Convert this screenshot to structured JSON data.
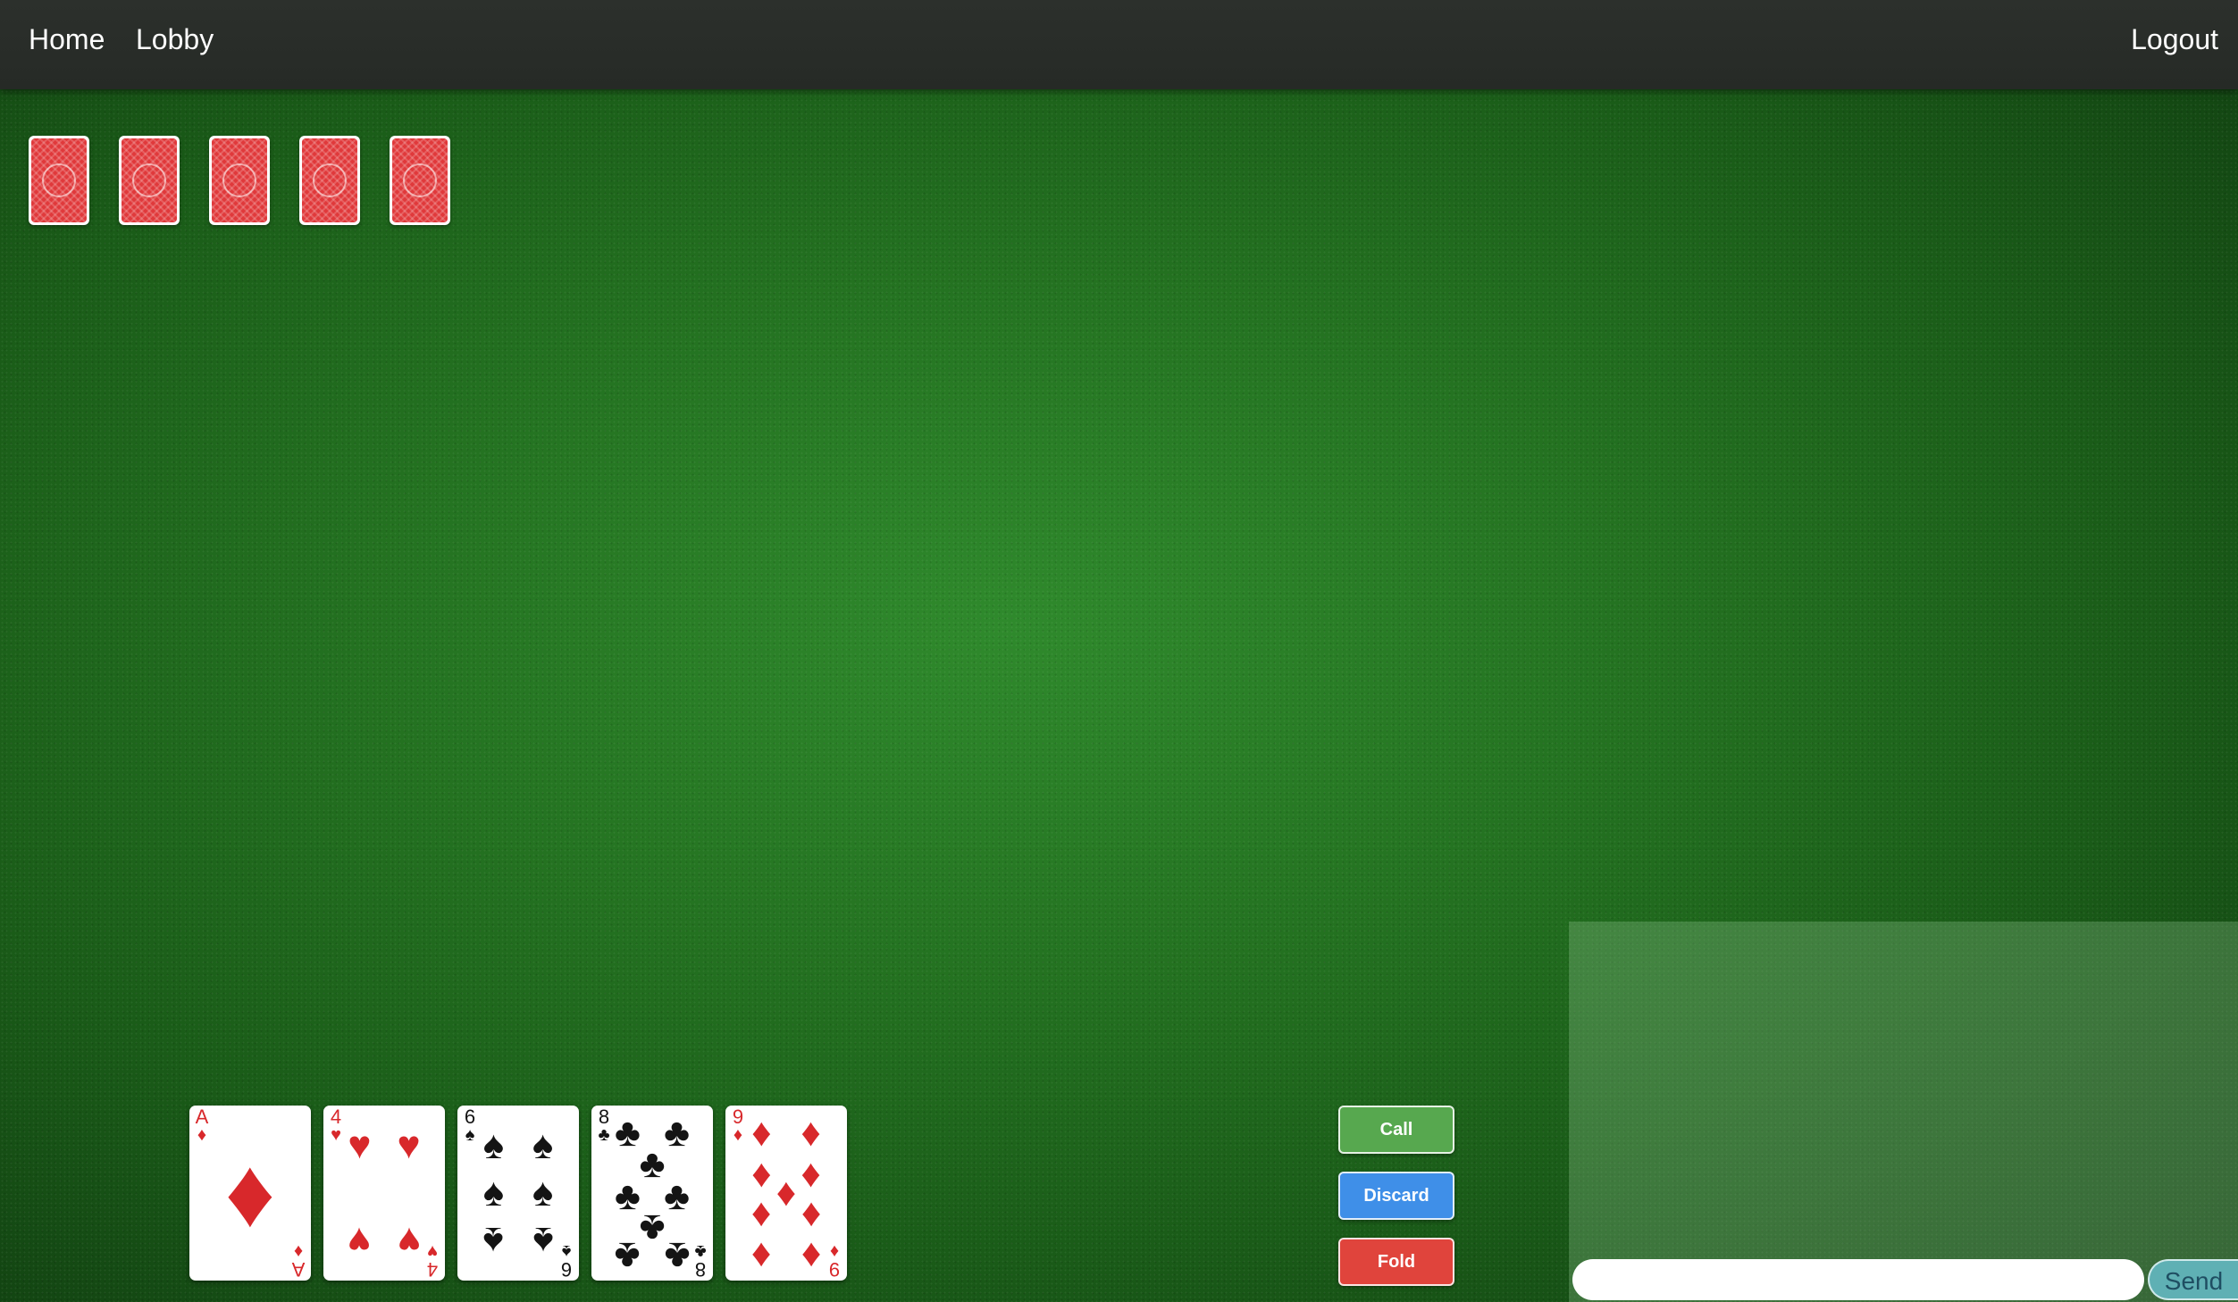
{
  "nav": {
    "home_label": "Home",
    "lobby_label": "Lobby",
    "logout_label": "Logout"
  },
  "opponent": {
    "card_back_count": 5
  },
  "player_hand": [
    {
      "rank": "A",
      "suit": "♦",
      "color": "red"
    },
    {
      "rank": "4",
      "suit": "♥",
      "color": "red"
    },
    {
      "rank": "6",
      "suit": "♠",
      "color": "black"
    },
    {
      "rank": "8",
      "suit": "♣",
      "color": "black"
    },
    {
      "rank": "9",
      "suit": "♦",
      "color": "red"
    }
  ],
  "actions": {
    "call_label": "Call",
    "discard_label": "Discard",
    "fold_label": "Fold"
  },
  "chat": {
    "input_value": "",
    "send_label": "Send"
  },
  "colors": {
    "felt": "#247321",
    "call": "#57a84f",
    "discard": "#3f8fe8",
    "fold": "#e0443c",
    "card_back": "#e0393b"
  }
}
